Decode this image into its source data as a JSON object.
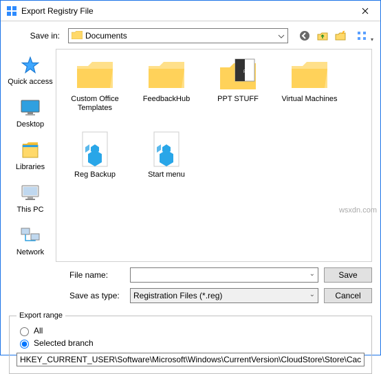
{
  "window": {
    "title": "Export Registry File"
  },
  "saveIn": {
    "label": "Save in:",
    "value": "Documents"
  },
  "sidebar": {
    "items": [
      {
        "label": "Quick access"
      },
      {
        "label": "Desktop"
      },
      {
        "label": "Libraries"
      },
      {
        "label": "This PC"
      },
      {
        "label": "Network"
      }
    ]
  },
  "files": [
    {
      "label": "Custom Office Templates",
      "type": "folder"
    },
    {
      "label": "FeedbackHub",
      "type": "folder"
    },
    {
      "label": "PPT STUFF",
      "type": "folder-doc"
    },
    {
      "label": "Virtual Machines",
      "type": "folder"
    },
    {
      "label": "Reg Backup",
      "type": "reg"
    },
    {
      "label": "Start menu",
      "type": "reg"
    }
  ],
  "fileName": {
    "label": "File name:",
    "value": ""
  },
  "saveAsType": {
    "label": "Save as type:",
    "value": "Registration Files (*.reg)"
  },
  "buttons": {
    "save": "Save",
    "cancel": "Cancel"
  },
  "exportRange": {
    "legend": "Export range",
    "all": "All",
    "selected": "Selected branch",
    "branchPath": "HKEY_CURRENT_USER\\Software\\Microsoft\\Windows\\CurrentVersion\\CloudStore\\Store\\Cache\\Def"
  },
  "watermark": "wsxdn.com"
}
